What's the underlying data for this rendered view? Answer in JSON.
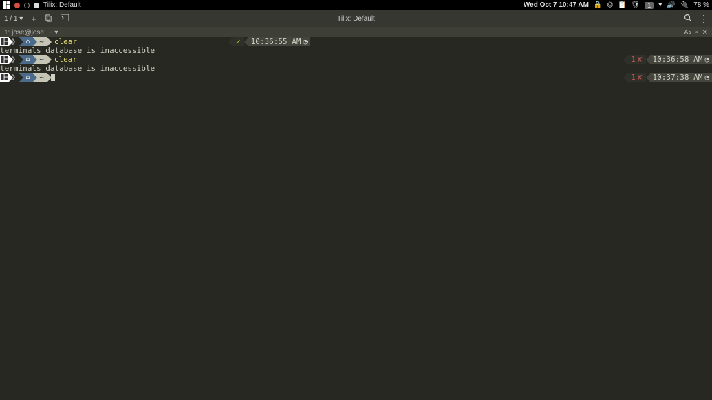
{
  "topbar": {
    "title": "Tilix: Default",
    "datetime": "Wed Oct 7  10:47 AM",
    "battery": "78 %",
    "workspace": "1"
  },
  "toolbar": {
    "session": "1 / 1",
    "title": "Tilix: Default"
  },
  "tab": {
    "label": "1: jose@jose: ~"
  },
  "prompt": {
    "home_glyph": "🏠",
    "tilde": "~",
    "clock": "⏱"
  },
  "lines": [
    {
      "cmd": "clear",
      "status": "ok",
      "status_text": "✓",
      "time": "10:36:55 AM",
      "right": "left"
    },
    {
      "output": "terminals database is inaccessible"
    },
    {
      "cmd": "clear",
      "status": "err",
      "status_code": "1",
      "status_text": "✘",
      "time": "10:36:58 AM",
      "right": "right"
    },
    {
      "output": "terminals database is inaccessible"
    },
    {
      "cmd": "",
      "cursor": true,
      "status": "err",
      "status_code": "1",
      "status_text": "✘",
      "time": "10:37:38 AM",
      "right": "right"
    }
  ]
}
